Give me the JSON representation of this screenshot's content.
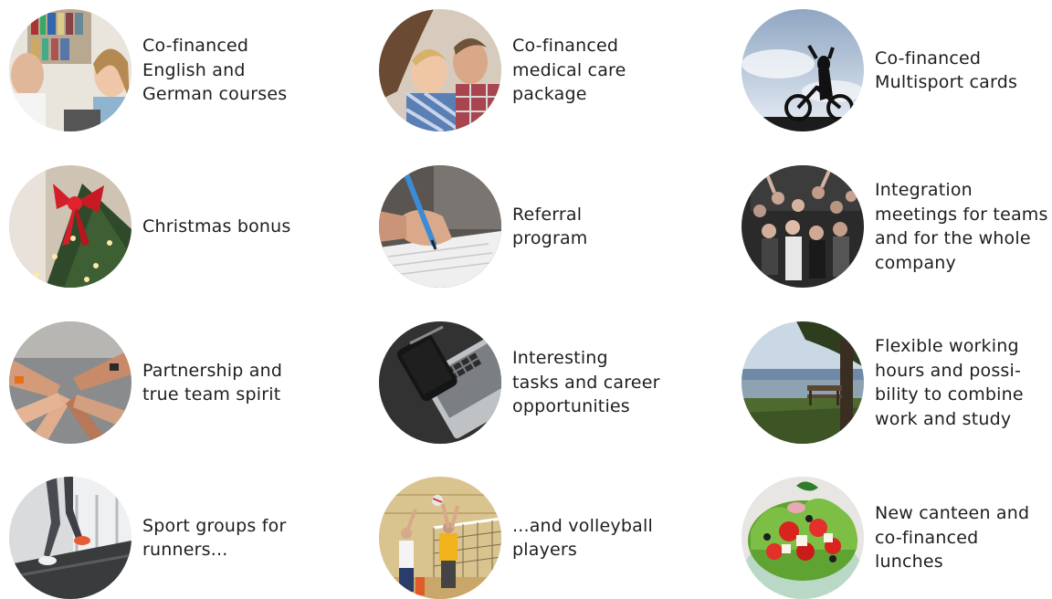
{
  "benefits": [
    {
      "label": "Co-financed\nEnglish and\nGerman courses",
      "photo": "people-studying-photo"
    },
    {
      "label": "Co-financed\nmedical care\npackage",
      "photo": "family-photo"
    },
    {
      "label": "Co-financed\nMultisport cards",
      "photo": "cyclist-silhouette-photo"
    },
    {
      "label": "Christmas bonus",
      "photo": "christmas-tree-photo"
    },
    {
      "label": "Referral\nprogram",
      "photo": "hand-writing-photo"
    },
    {
      "label": "Integration\nmeetings for teams\nand for the whole\ncompany",
      "photo": "group-party-photo"
    },
    {
      "label": "Partnership and\ntrue team spirit",
      "photo": "stacked-hands-photo"
    },
    {
      "label": "Interesting\ntasks and career\nopportunities",
      "photo": "laptop-desk-photo"
    },
    {
      "label": "Flexible working\nhours and possi-\nbility to combine\nwork and study",
      "photo": "park-bench-photo"
    },
    {
      "label": "Sport groups for\nrunners...",
      "photo": "treadmill-runner-photo"
    },
    {
      "label": "...and volleyball\nplayers",
      "photo": "volleyball-players-photo"
    },
    {
      "label": "New canteen and\nco-financed lunches",
      "photo": "salad-bowl-photo"
    }
  ]
}
